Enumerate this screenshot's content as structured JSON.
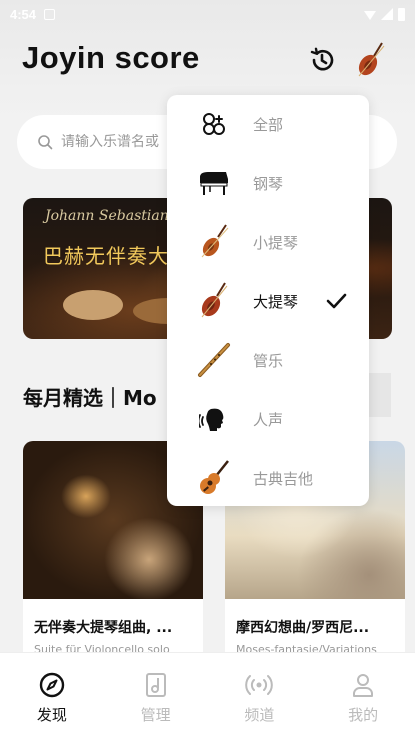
{
  "status_bar": {
    "time": "4:54"
  },
  "app": {
    "title": "Joyin score"
  },
  "search": {
    "placeholder": "请输入乐谱名或"
  },
  "banner": {
    "script_text": "Johann Sebastian B",
    "title": "巴赫无伴奏大"
  },
  "section": {
    "title": "每月精选｜Mo"
  },
  "cards": [
    {
      "title": "无伴奏大提琴组曲, ...",
      "subtitle": "Suite für Violoncello solo"
    },
    {
      "title": "摩西幻想曲/罗西尼...",
      "subtitle": "Moses-fantasie/Variations"
    }
  ],
  "tabs": [
    {
      "label": "发现",
      "icon": "compass-icon",
      "active": true
    },
    {
      "label": "管理",
      "icon": "music-note-icon",
      "active": false
    },
    {
      "label": "频道",
      "icon": "broadcast-icon",
      "active": false
    },
    {
      "label": "我的",
      "icon": "person-icon",
      "active": false
    }
  ],
  "instrument_menu": {
    "items": [
      {
        "label": "全部",
        "icon": "all-icon",
        "selected": false
      },
      {
        "label": "钢琴",
        "icon": "piano-icon",
        "selected": false
      },
      {
        "label": "小提琴",
        "icon": "violin-icon",
        "selected": false
      },
      {
        "label": "大提琴",
        "icon": "cello-icon",
        "selected": true
      },
      {
        "label": "管乐",
        "icon": "flute-icon",
        "selected": false
      },
      {
        "label": "人声",
        "icon": "voice-icon",
        "selected": false
      },
      {
        "label": "古典吉他",
        "icon": "guitar-icon",
        "selected": false
      }
    ]
  },
  "colors": {
    "accent": "#111111",
    "muted": "#999999",
    "banner_text": "#f2c95c",
    "violin_wood": "#a8401c"
  }
}
